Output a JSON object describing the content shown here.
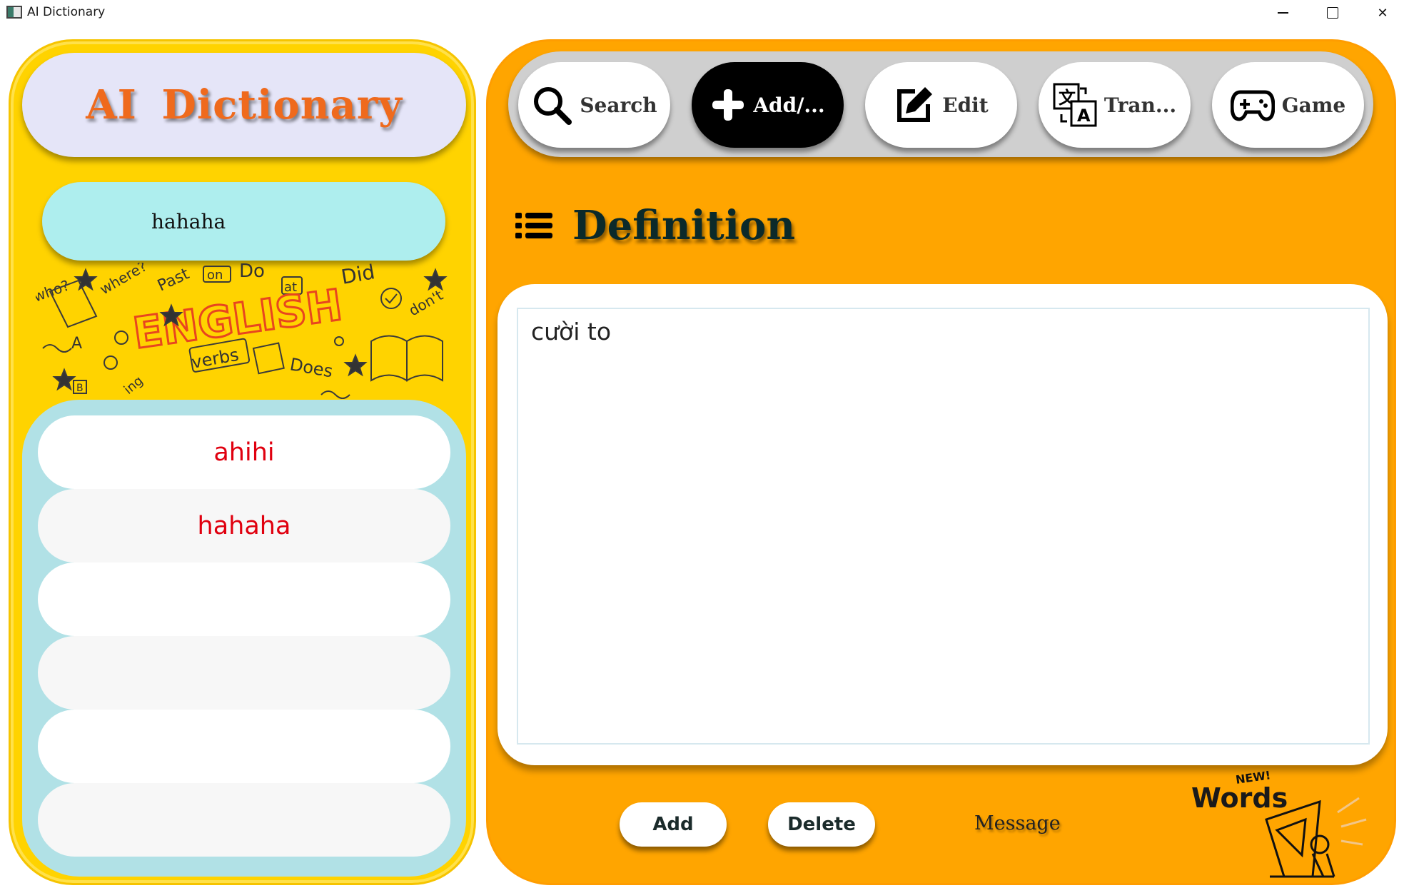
{
  "window": {
    "title": "AI Dictionary",
    "controls": {
      "minimize": "—",
      "maximize": "☐",
      "close": "✕"
    }
  },
  "sidebar": {
    "logo_text": "AI Dictionary",
    "search_value": "hahaha",
    "doodle_words": [
      "who?",
      "where?",
      "Past",
      "on",
      "Do",
      "at",
      "Did",
      "don't",
      "ENGLISH",
      "verbs",
      "Does",
      "ing",
      "A",
      "B"
    ],
    "word_list": [
      "ahihi",
      "hahaha",
      "",
      "",
      "",
      ""
    ]
  },
  "toolbar": {
    "tabs": [
      {
        "label": "Search",
        "icon": "search-icon",
        "active": false
      },
      {
        "label": "Add/...",
        "icon": "plus-icon",
        "active": true
      },
      {
        "label": "Edit",
        "icon": "edit-icon",
        "active": false
      },
      {
        "label": "Tran...",
        "icon": "translate-icon",
        "active": false
      },
      {
        "label": "Game",
        "icon": "gamepad-icon",
        "active": false
      }
    ]
  },
  "main": {
    "section_title": "Definition",
    "definition_text": "cười to\n",
    "add_label": "Add",
    "delete_label": "Delete",
    "message_label": "Message",
    "words_logo": {
      "new_tag": "NEW!",
      "word": "Words"
    }
  },
  "colors": {
    "sidebar_bg": "#ffd300",
    "main_bg": "#ffa500",
    "logo_text": "#ef6a1d",
    "list_word": "#e0000f",
    "search_bg": "#aeeeee",
    "list_bg": "#b1e1e6"
  }
}
